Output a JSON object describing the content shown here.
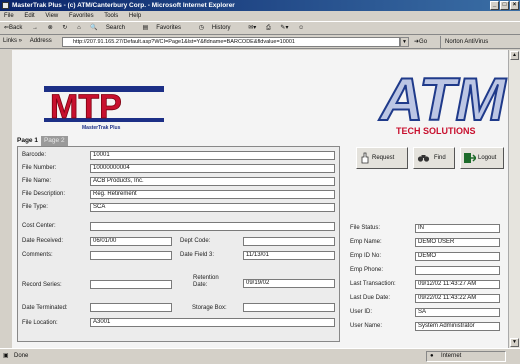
{
  "window": {
    "title": "MasterTrak Plus - (c) ATM/Canterbury Corp. - Microsoft Internet Explorer",
    "controls": [
      "_",
      "□",
      "×"
    ]
  },
  "menu": [
    "File",
    "Edit",
    "View",
    "Favorites",
    "Tools",
    "Help"
  ],
  "toolbar": {
    "back": "⇐Back",
    "forward": "→",
    "search": "Search",
    "favorites": "Favorites",
    "history": "History"
  },
  "address": {
    "links": "Links »",
    "label": "Address",
    "url": "http://207.91.165.27/Default.asp?WCI=Page1&lst=Y&fldname=BARCODE&fldvalue=10001",
    "go": "Go",
    "norton": "Norton AntiVirus"
  },
  "logos": {
    "mtp": {
      "letters": "MTP",
      "tagline": "MasterTrak Plus",
      "icon": "mastertrak-logo"
    },
    "atm": {
      "letters": "ATM",
      "tagline": "TECH SOLUTIONS",
      "icon": "atm-logo"
    }
  },
  "tabs": {
    "active": "Page 1",
    "inactive": "Page 2"
  },
  "form": {
    "barcode": {
      "label": "Barcode:",
      "value": "10001"
    },
    "file_number": {
      "label": "File Number:",
      "value": "10000000004"
    },
    "file_name": {
      "label": "File Name:",
      "value": "ACB Products, Inc."
    },
    "file_description": {
      "label": "File Description:",
      "value": "Reg. Retirement"
    },
    "file_type": {
      "label": "File Type:",
      "value": "SCA"
    },
    "cost_center": {
      "label": "Cost Center:",
      "value": ""
    },
    "date_received": {
      "label": "Date Received:",
      "value": "06/01/00"
    },
    "dept_code": {
      "label": "Dept Code:",
      "value": ""
    },
    "comments": {
      "label": "Comments:",
      "value": ""
    },
    "date_field_3": {
      "label": "Date Field 3:",
      "value": "11/13/01"
    },
    "record_series": {
      "label": "Record Series:",
      "value": ""
    },
    "retention_date": {
      "label_line1": "Retention",
      "label_line2": "Date:",
      "value": "09/19/02"
    },
    "date_terminated": {
      "label": "Date Terminated:",
      "value": ""
    },
    "storage_box": {
      "label": "Storage Box:",
      "value": ""
    },
    "file_location": {
      "label": "File Location:",
      "value": "A3001"
    }
  },
  "buttons": {
    "request": "Request",
    "find": "Find",
    "logout": "Logout"
  },
  "status_panel": {
    "file_status": {
      "label": "File Status:",
      "value": "IN"
    },
    "emp_name": {
      "label": "Emp Name:",
      "value": "DEMO USER"
    },
    "emp_id": {
      "label": "Emp ID No:",
      "value": "DEMO"
    },
    "emp_phone": {
      "label": "Emp Phone:",
      "value": ""
    },
    "last_transaction": {
      "label": "Last Transaction:",
      "value": "09/12/02 11:43:27 AM"
    },
    "last_due_date": {
      "label": "Last Due Date:",
      "value": "09/22/02 11:43:22 AM"
    },
    "user_id": {
      "label": "User ID:",
      "value": "SA"
    },
    "user_name": {
      "label": "User Name:",
      "value": "System Administrator"
    }
  },
  "statusbar": {
    "left": "Done",
    "zone": "Internet"
  },
  "colors": {
    "accent_red": "#c8102e",
    "atm_blue": "#1f3a8a",
    "title_bar": "#0a246a"
  }
}
